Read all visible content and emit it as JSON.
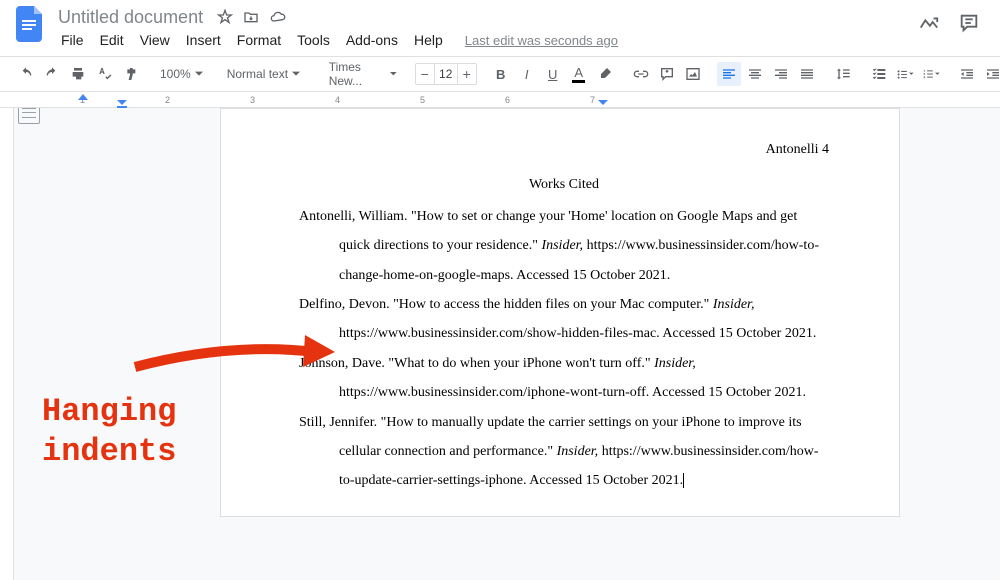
{
  "header": {
    "doc_title": "Untitled document",
    "last_edit": "Last edit was seconds ago"
  },
  "menu": {
    "file": "File",
    "edit": "Edit",
    "view": "View",
    "insert": "Insert",
    "format": "Format",
    "tools": "Tools",
    "addons": "Add-ons",
    "help": "Help"
  },
  "toolbar": {
    "zoom": "100%",
    "style": "Normal text",
    "font": "Times New...",
    "font_size": "12"
  },
  "document": {
    "page_header": "Antonelli 4",
    "title": "Works Cited",
    "entries": [
      {
        "author_title": "Antonelli, William. \"How to set or change your 'Home' location on Google Maps and get quick directions to your residence.\" ",
        "publication": "Insider,",
        "url_access": " https://www.businessinsider.com/how-to-change-home-on-google-maps. Accessed 15 October 2021."
      },
      {
        "author_title": "Delfino, Devon. \"How to access the hidden files on your Mac computer.\" ",
        "publication": "Insider,",
        "url_access": " https://www.businessinsider.com/show-hidden-files-mac. Accessed 15 October 2021."
      },
      {
        "author_title": "Johnson, Dave. \"What to do when your iPhone won't turn off.\" ",
        "publication": "Insider,",
        "url_access": " https://www.businessinsider.com/iphone-wont-turn-off. Accessed 15 October 2021."
      },
      {
        "author_title": "Still, Jennifer. \"How to manually update the carrier settings on your iPhone to improve its cellular connection and performance.\" ",
        "publication": "Insider,",
        "url_access": " https://www.businessinsider.com/how-to-update-carrier-settings-iphone. Accessed 15 October 2021."
      }
    ]
  },
  "annotation": {
    "line1": "Hanging",
    "line2": "indents"
  },
  "ruler": {
    "n1": "1",
    "n2": "2",
    "n3": "3",
    "n4": "4",
    "n5": "5",
    "n6": "6",
    "n7": "7"
  }
}
